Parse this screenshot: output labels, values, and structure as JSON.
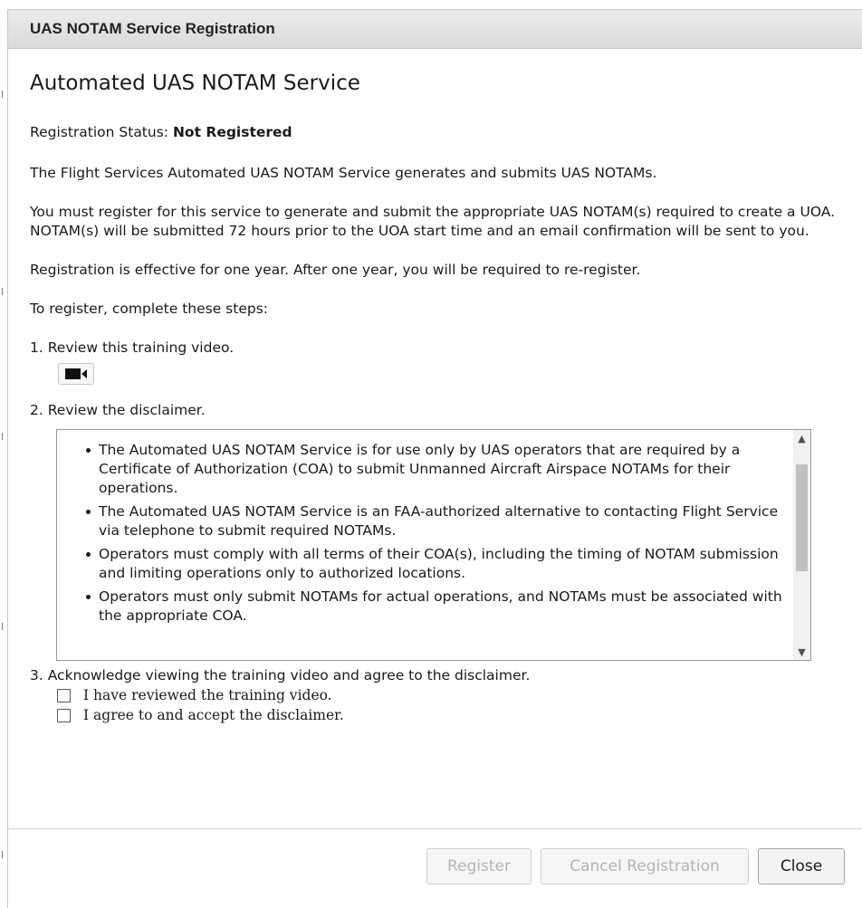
{
  "dialog": {
    "title": "UAS NOTAM Service Registration"
  },
  "content": {
    "heading": "Automated UAS NOTAM Service",
    "status_label": "Registration Status:",
    "status_value": "Not Registered",
    "para1": "The Flight Services Automated UAS NOTAM Service generates and submits UAS NOTAMs.",
    "para2": "You must register for this service to generate and submit the appropriate UAS NOTAM(s) required to create a UOA. NOTAM(s) will be submitted 72 hours prior to the UOA start time and an email confirmation will be sent to you.",
    "para3": "Registration is effective for one year. After one year, you will be required to re-register.",
    "para4": "To register, complete these steps:",
    "step1": "1. Review this training video.",
    "video_icon": "video-camera-icon",
    "step2": "2. Review the disclaimer.",
    "disclaimer_items": [
      "The Automated UAS NOTAM Service is for use only by UAS operators that are required by a Certificate of Authorization (COA) to submit Unmanned Aircraft Airspace NOTAMs for their operations.",
      "The Automated UAS NOTAM Service is an FAA-authorized alternative to contacting Flight Service via telephone to submit required NOTAMs.",
      "Operators must comply with all terms of their COA(s), including the timing of NOTAM submission and limiting operations only to authorized locations.",
      "Operators must only submit NOTAMs for actual operations, and NOTAMs must be associated with the appropriate COA."
    ],
    "step3": "3. Acknowledge viewing the training video and agree to the disclaimer.",
    "checkbox1_label": "I have reviewed the training video.",
    "checkbox1_checked": false,
    "checkbox2_label": "I agree to and accept the disclaimer.",
    "checkbox2_checked": false
  },
  "footer": {
    "register_label": "Register",
    "cancel_label": "Cancel Registration",
    "close_label": "Close",
    "disabled_color": "#b3b3b3"
  }
}
